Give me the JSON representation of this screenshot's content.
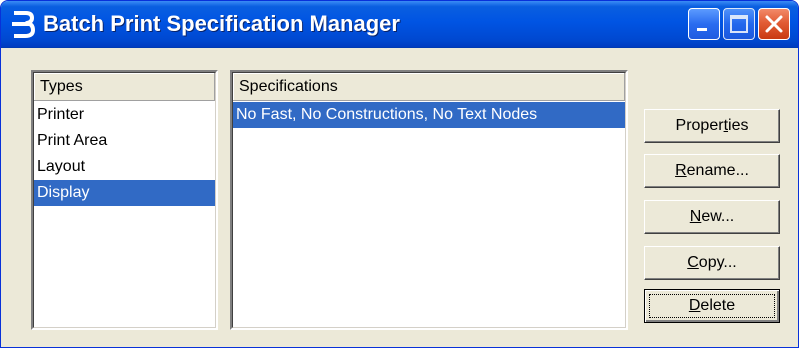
{
  "window": {
    "title": "Batch Print Specification Manager",
    "app_icon": "bentley-b-icon",
    "controls": [
      "minimize-icon",
      "maximize-icon",
      "close-icon"
    ]
  },
  "types": {
    "header": "Types",
    "items": [
      {
        "label": "Printer",
        "selected": false
      },
      {
        "label": "Print Area",
        "selected": false
      },
      {
        "label": "Layout",
        "selected": false
      },
      {
        "label": "Display",
        "selected": true
      }
    ]
  },
  "specifications": {
    "header": "Specifications",
    "items": [
      {
        "label": "No Fast, No Constructions, No Text Nodes",
        "selected": true
      }
    ]
  },
  "buttons": {
    "properties": {
      "pre": "Proper",
      "mnemonic": "t",
      "post": "ies"
    },
    "rename": {
      "pre": "",
      "mnemonic": "R",
      "post": "ename..."
    },
    "new": {
      "pre": "",
      "mnemonic": "N",
      "post": "ew..."
    },
    "copy": {
      "pre": "",
      "mnemonic": "C",
      "post": "opy..."
    },
    "delete": {
      "pre": "",
      "mnemonic": "D",
      "post": "elete"
    }
  },
  "colors": {
    "titlebar": "#0054e3",
    "selection": "#316ac5",
    "dialog_bg": "#ece9d8",
    "close_button": "#e25c35"
  }
}
